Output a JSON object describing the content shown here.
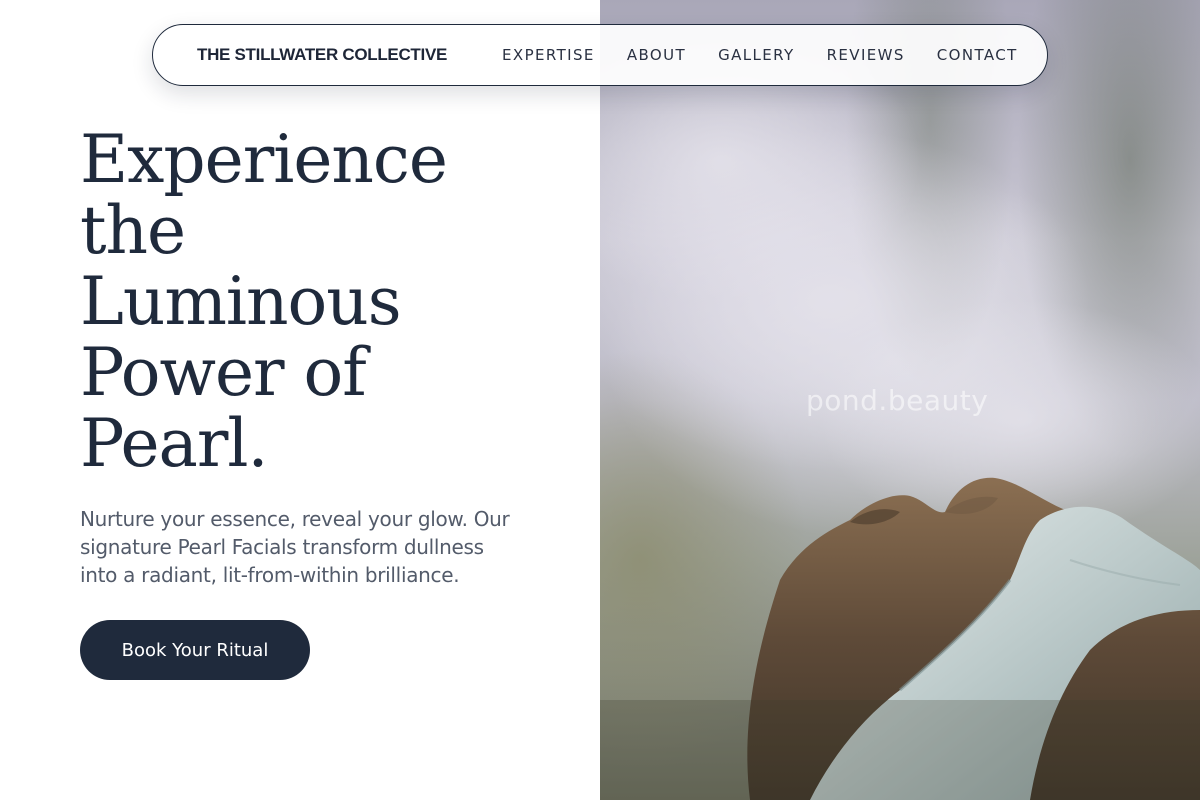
{
  "header": {
    "brand": "THE STILLWATER COLLECTIVE",
    "nav": [
      {
        "label": "EXPERTISE"
      },
      {
        "label": "ABOUT"
      },
      {
        "label": "GALLERY"
      },
      {
        "label": "REVIEWS"
      },
      {
        "label": "CONTACT"
      }
    ]
  },
  "hero": {
    "headline_lines": [
      "Experience",
      "the",
      "Luminous",
      "Power of",
      "Pearl."
    ],
    "subcopy_lines": [
      "Nurture your essence, reveal your glow. Our",
      "signature Pearl Facials transform dullness",
      "into a radiant, lit-from-within brilliance."
    ],
    "cta_label": "Book Your Ritual",
    "image_watermark": "pond.beauty"
  },
  "colors": {
    "navy": "#1f2a3c",
    "body_text": "#535b6a",
    "background": "#ffffff"
  }
}
